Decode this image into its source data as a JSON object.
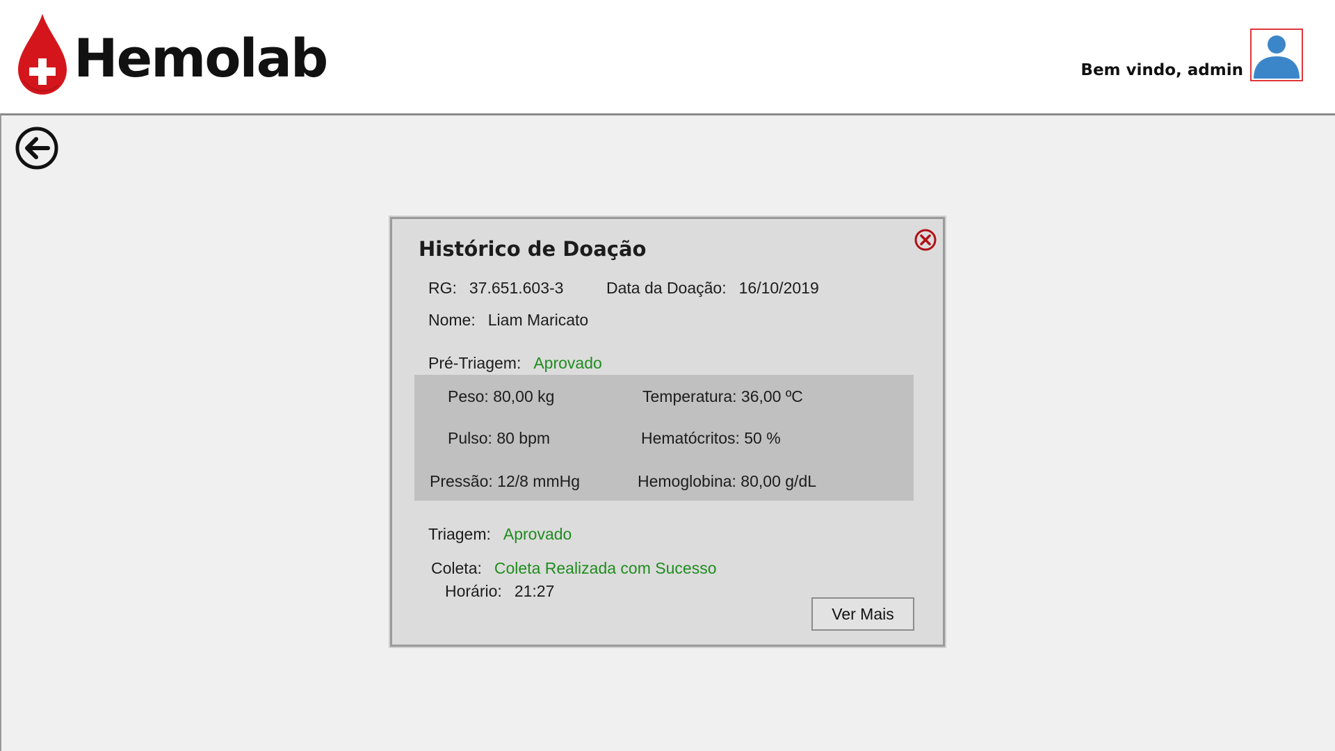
{
  "header": {
    "brand": "Hemolab",
    "welcome": "Bem vindo, admin"
  },
  "icons": {
    "logo": "blood-drop-cross-icon",
    "avatar": "user-avatar-icon",
    "back": "arrow-left-circle-icon",
    "close": "close-circle-icon"
  },
  "colors": {
    "brand_red": "#d4161c",
    "status_ok": "#1e8c1e",
    "avatar_blue": "#3b86c8"
  },
  "modal": {
    "title": "Histórico de Doação",
    "rg_label": "RG:",
    "rg_value": "37.651.603-3",
    "date_label": "Data da Doação:",
    "date_value": "16/10/2019",
    "name_label": "Nome:",
    "name_value": "Liam Maricato",
    "pretriagem_label": "Pré-Triagem:",
    "pretriagem_value": "Aprovado",
    "vitals": {
      "peso": "Peso: 80,00 kg",
      "temperatura": "Temperatura: 36,00 ºC",
      "pulso": "Pulso: 80 bpm",
      "hematocritos": "Hematócritos: 50 %",
      "pressao": "Pressão: 12/8 mmHg",
      "hemoglobina": "Hemoglobina: 80,00 g/dL"
    },
    "triagem_label": "Triagem:",
    "triagem_value": "Aprovado",
    "coleta_label": "Coleta:",
    "coleta_value": "Coleta Realizada com Sucesso",
    "horario_label": "Horário:",
    "horario_value": "21:27",
    "ver_mais": "Ver Mais"
  }
}
